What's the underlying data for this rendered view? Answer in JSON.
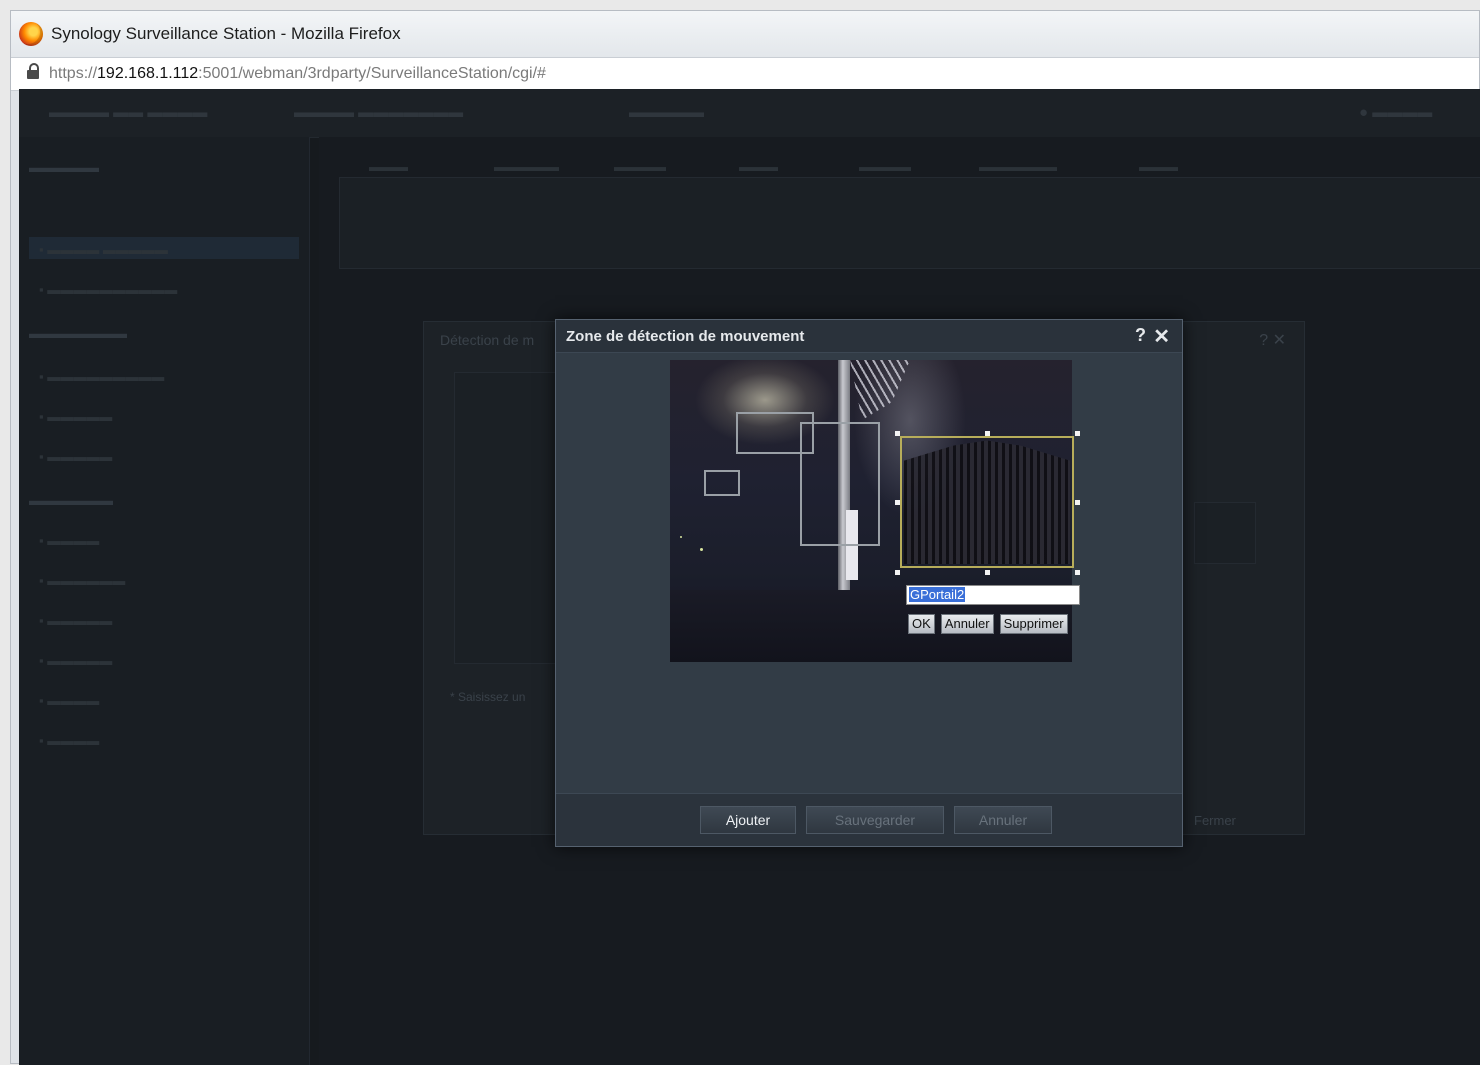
{
  "browser": {
    "window_title": "Synology Surveillance Station - Mozilla Firefox",
    "url_prefix": "https://",
    "url_host": "192.168.1.112",
    "url_rest": ":5001/webman/3rdparty/SurveillanceStation/cgi/#"
  },
  "dialog": {
    "title": "Zone de détection de mouvement",
    "help_glyph": "?",
    "close_glyph": "✕",
    "zone_name_value": "GPortail2",
    "ok_label": "OK",
    "cancel_label": "Annuler",
    "delete_label": "Supprimer",
    "add_label": "Ajouter",
    "save_label": "Sauvegarder",
    "cancel_footer_label": "Annuler"
  },
  "background_dialog": {
    "title": "Détection de m",
    "close_label": "Fermer",
    "note": "* Saisissez un"
  },
  "icons": [
    "firefox-logo-icon",
    "lock-icon",
    "help-icon",
    "close-icon"
  ],
  "colors": {
    "app_background": "#161a1e",
    "dialog_background": "#323c46",
    "selection_highlight": "#3a6fd8",
    "selected_zone_border": "#b7ad5a"
  }
}
